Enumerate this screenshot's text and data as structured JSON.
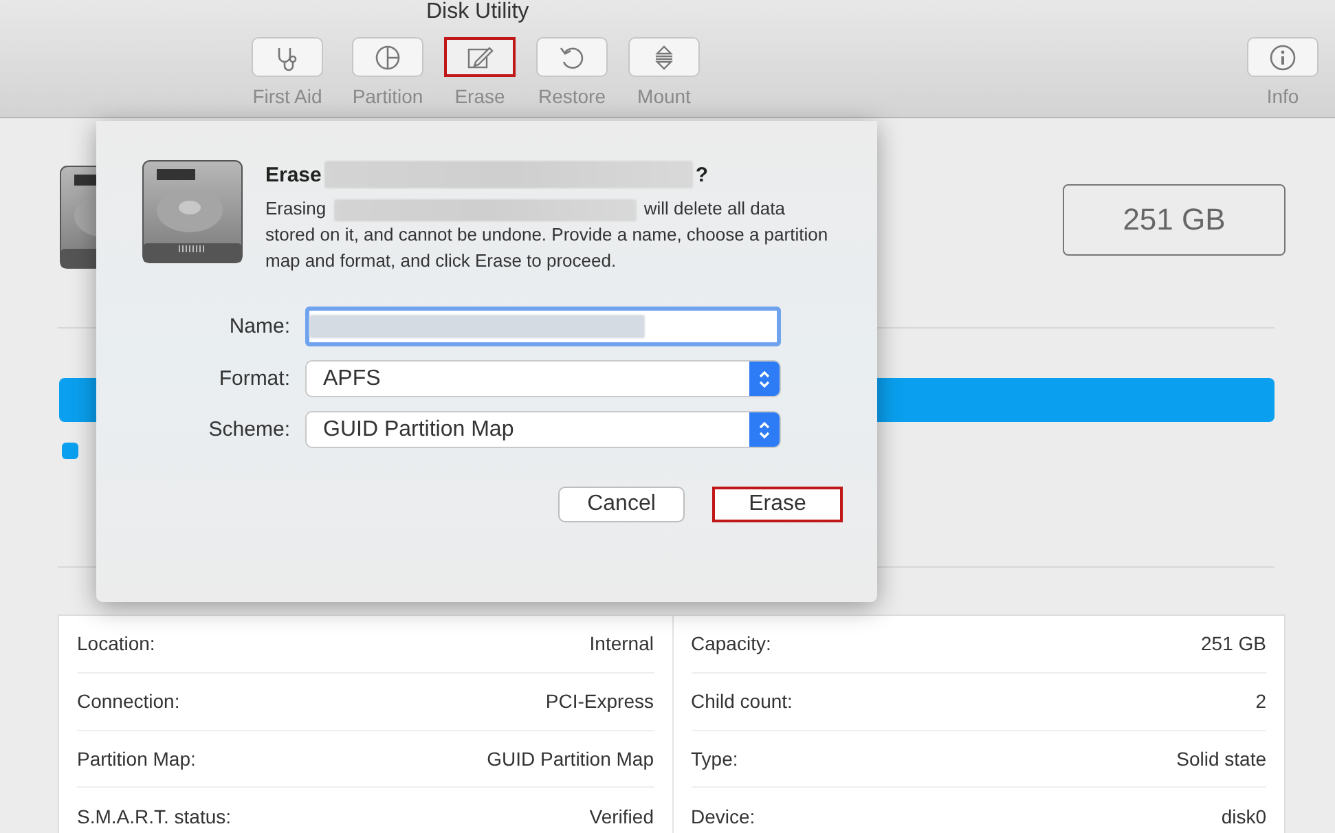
{
  "window": {
    "title": "Disk Utility"
  },
  "toolbar": [
    {
      "kind": "first-aid",
      "label": "First Aid",
      "highlighted": false
    },
    {
      "kind": "partition",
      "label": "Partition",
      "highlighted": false
    },
    {
      "kind": "erase",
      "label": "Erase",
      "highlighted": true
    },
    {
      "kind": "restore",
      "label": "Restore",
      "highlighted": false
    },
    {
      "kind": "mount",
      "label": "Mount",
      "highlighted": false
    },
    {
      "kind": "info",
      "label": "Info",
      "highlighted": false
    }
  ],
  "disk": {
    "size": "251 GB"
  },
  "info": {
    "left": [
      {
        "label": "Location:",
        "value": "Internal"
      },
      {
        "label": "Connection:",
        "value": "PCI-Express"
      },
      {
        "label": "Partition Map:",
        "value": "GUID Partition Map"
      },
      {
        "label": "S.M.A.R.T. status:",
        "value": "Verified"
      }
    ],
    "right": [
      {
        "label": "Capacity:",
        "value": "251 GB"
      },
      {
        "label": "Child count:",
        "value": "2"
      },
      {
        "label": "Type:",
        "value": "Solid state"
      },
      {
        "label": "Device:",
        "value": "disk0"
      }
    ]
  },
  "dialog": {
    "title_start": "Erase",
    "title_end": "?",
    "message_start": "Erasing",
    "message_end": "will delete all data stored on it, and cannot be undone. Provide a name, choose a partition map and format, and click Erase to proceed.",
    "fields": [
      {
        "kind": "text",
        "label": "Name:"
      },
      {
        "kind": "popup",
        "label": "Format:",
        "value": "APFS"
      },
      {
        "kind": "popup",
        "label": "Scheme:",
        "value": "GUID Partition Map"
      }
    ],
    "buttons": [
      {
        "label": "Cancel",
        "highlighted": false
      },
      {
        "label": "Erase",
        "highlighted": true
      }
    ]
  }
}
